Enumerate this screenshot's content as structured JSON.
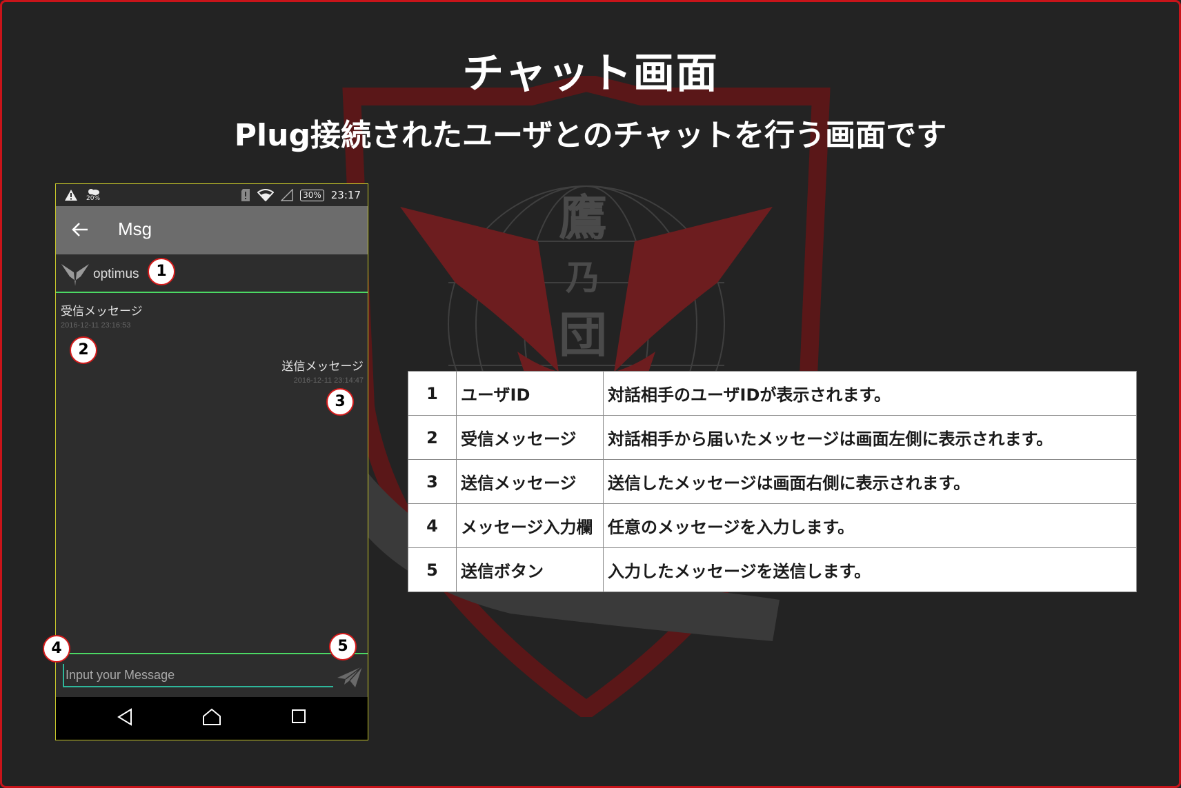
{
  "title": "チャット画面",
  "subtitle": "Plug接続されたユーザとのチャットを行う画面です",
  "phone": {
    "status_bar": {
      "left_icons": [
        "warning-icon",
        "weather-icon"
      ],
      "weather_temp": "20%",
      "battery": "30%",
      "time": "23:17"
    },
    "app_bar": {
      "title": "Msg"
    },
    "user_id": "optimus",
    "received": {
      "text": "受信メッセージ",
      "time": "2016-12-11 23:16:53"
    },
    "sent": {
      "text": "送信メッセージ",
      "time": "2016-12-11 23:14:47"
    },
    "input": {
      "placeholder": "Input your Message"
    }
  },
  "markers": [
    "1",
    "2",
    "3",
    "4",
    "5"
  ],
  "table": [
    {
      "num": "1",
      "name": "ユーザID",
      "desc": "対話相手のユーザIDが表示されます。"
    },
    {
      "num": "2",
      "name": "受信メッセージ",
      "desc": "対話相手から届いたメッセージは画面左側に表示されます。"
    },
    {
      "num": "3",
      "name": "送信メッセージ",
      "desc": "送信したメッセージは画面右側に表示されます。"
    },
    {
      "num": "4",
      "name": "メッセージ入力欄",
      "desc": "任意のメッセージを入力します。"
    },
    {
      "num": "5",
      "name": "送信ボタン",
      "desc": "入力したメッセージを送信します。"
    }
  ],
  "colors": {
    "frame": "#c8141a",
    "accent_green": "#4cd964",
    "input_underline": "#2eb79b"
  }
}
